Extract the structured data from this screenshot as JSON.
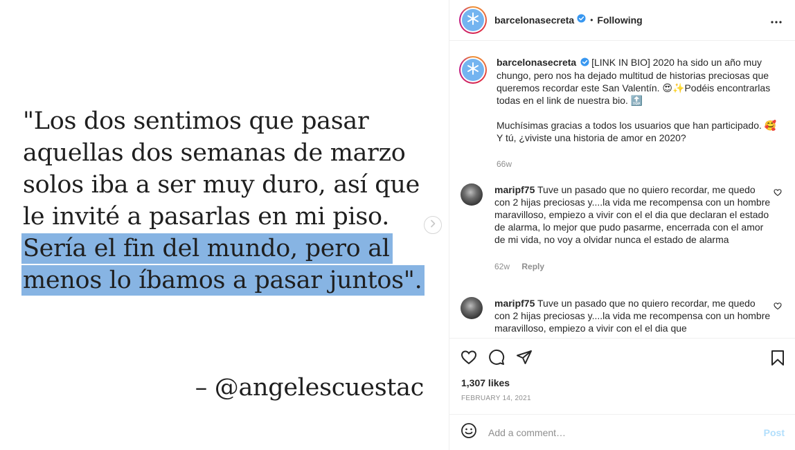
{
  "media": {
    "quote_lines": [
      "\"Los dos sentimos que pasar",
      "aquellas dos semanas de marzo",
      "solos iba a ser muy duro, así que",
      "le invité a pasarlas en mi piso."
    ],
    "highlight_lines": [
      "Sería el fin del mundo, pero al",
      "menos lo íbamos a pasar juntos\"."
    ],
    "signature": "– @angelescuestac",
    "highlight_color": "#87b4e3"
  },
  "header": {
    "username": "barcelonasecreta",
    "separator": "•",
    "follow_status": "Following"
  },
  "caption": {
    "username": "barcelonasecreta",
    "paragraph1": "[LINK IN BIO] 2020 ha sido un año muy chungo, pero nos ha dejado multitud de historias preciosas que queremos recordar este San Valentín. 😍✨Podéis encontrarlas todas en el link de nuestra bio. 🔝",
    "paragraph2": "Muchísimas gracias a todos los usuarios que han participado. 🥰 Y tú, ¿viviste una historia de amor en 2020?",
    "time": "66w"
  },
  "comments": [
    {
      "username": "maripf75",
      "text": "Tuve un pasado que no quiero recordar, me quedo con 2 hijas preciosas y....la vida me recompensa con un hombre maravilloso, empiezo a vivir con el el dia que declaran el estado de alarma, lo mejor que pudo pasarme, encerrada con el amor de mi vida, no voy a olvidar nunca el estado de alarma",
      "time": "62w",
      "reply": "Reply"
    },
    {
      "username": "maripf75",
      "text": "Tuve un pasado que no quiero recordar, me quedo con 2 hijas preciosas y....la vida me recompensa con un hombre maravilloso, empiezo a vivir con el el dia que"
    }
  ],
  "actions": {
    "likes": "1,307 likes",
    "date": "February 14, 2021"
  },
  "composer": {
    "placeholder": "Add a comment…",
    "post_label": "Post"
  },
  "colors": {
    "verified": "#3897f0",
    "avatar": "#74b4f0",
    "post_disabled": "#b2dffc",
    "muted": "#8e8e8e"
  }
}
